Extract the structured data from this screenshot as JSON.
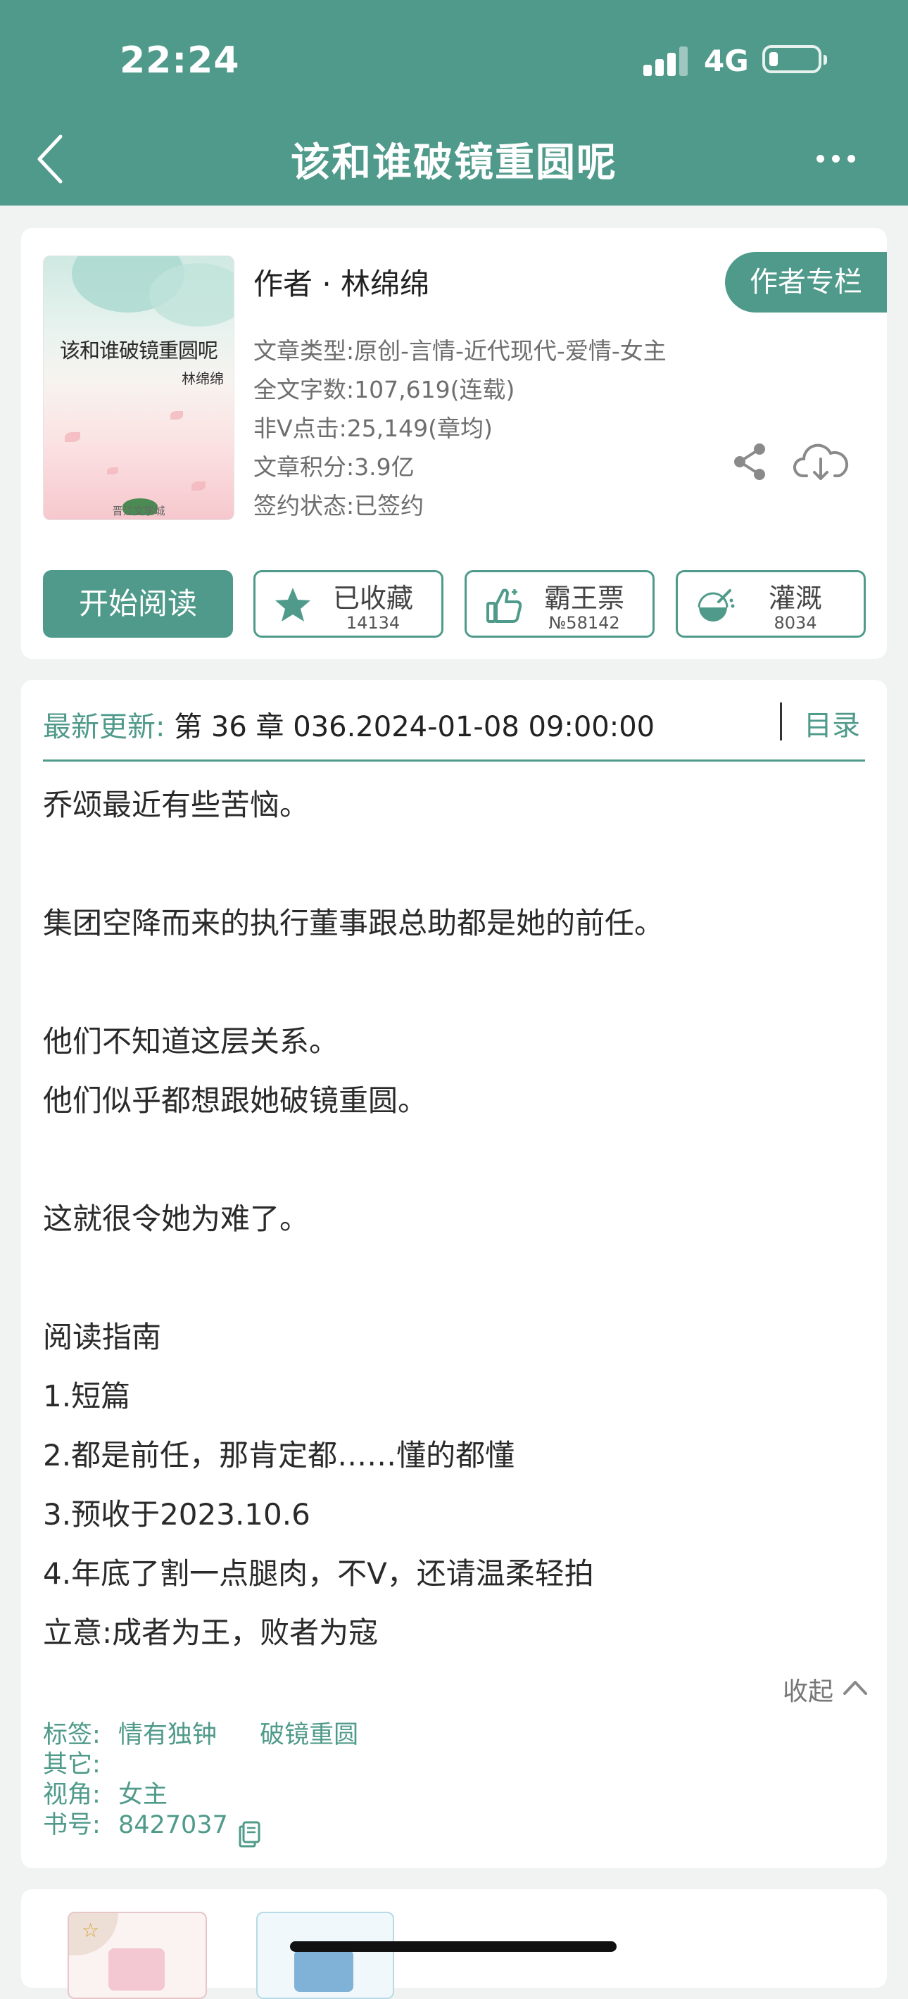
{
  "status_bar": {
    "time": "22:24",
    "network": "4G"
  },
  "nav": {
    "title": "该和谁破镜重圆呢"
  },
  "book": {
    "cover_title": "该和谁破镜重圆呢",
    "cover_author": "林绵绵",
    "cover_publisher": "晋江文学城",
    "author_line": "作者 · 林绵绵",
    "author_column": "作者专栏",
    "meta": [
      "文章类型:原创-言情-近代现代-爱情-女主",
      "全文字数:107,619(连载)",
      "非Ⅴ点击:25,149(章均)",
      "文章积分:3.9亿",
      "签约状态:已签约"
    ]
  },
  "actions": {
    "start_reading": "开始阅读",
    "favorite": {
      "label": "已收藏",
      "count": "14134"
    },
    "vote": {
      "label": "霸王票",
      "count": "№58142"
    },
    "water": {
      "label": "灌溉",
      "count": "8034"
    }
  },
  "update": {
    "label": "最新更新:",
    "chapter": " 第 36 章 036.2024-01-08 09:00:00",
    "toc": "目录"
  },
  "synopsis": [
    "乔颂最近有些苦恼。",
    "集团空降而来的执行董事跟总助都是她的前任。",
    "他们不知道这层关系。",
    "他们似乎都想跟她破镜重圆。",
    "这就很令她为难了。",
    "阅读指南",
    "1.短篇",
    "2.都是前任，那肯定都……懂的都懂",
    "3.预收于2023.10.6",
    "4.年底了割一点腿肉，不Ⅴ，还请温柔轻拍",
    "立意:成者为王，败者为寇"
  ],
  "collapse_label": "收起",
  "details": {
    "tags_label": "标签:",
    "tag1": "情有独钟",
    "tag2": "破镜重圆",
    "other_label": "其它:",
    "view_label": "视角:",
    "view_value": "女主",
    "book_id_label": "书号:",
    "book_id": "8427037"
  },
  "colors": {
    "accent": "#4f9a8a",
    "background": "#f1f3f2"
  }
}
